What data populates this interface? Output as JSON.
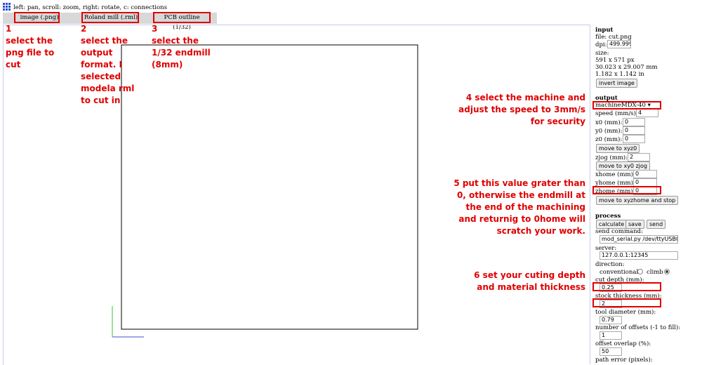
{
  "help_text": "left: pan, scroll: zoom, right: rotate, c: connections",
  "tabs": [
    "image (.png)",
    "Roland mill (.rml)",
    "PCB outline (1/32)"
  ],
  "annotations": {
    "a1": {
      "num": "1",
      "lines": [
        "select the",
        "png file to",
        "cut"
      ]
    },
    "a2": {
      "num": "2",
      "lines": [
        "select the",
        "output",
        "format. I",
        "selected",
        "modela rml",
        "to cut in"
      ]
    },
    "a3": {
      "num": "3",
      "lines": [
        "select the",
        "1/32 endmill",
        "(8mm)"
      ]
    },
    "a4": {
      "lines": [
        "4 select the machine and",
        "adjust the speed to 3mm/s",
        "for security"
      ]
    },
    "a5": {
      "lines": [
        "5 put this value grater than",
        "0, otherwise the endmill at",
        "the end of the machining",
        "and returnig to 0home will",
        "scratch your work."
      ]
    },
    "a6": {
      "lines": [
        "6 set your cuting depth",
        "and material thickness"
      ]
    }
  },
  "panel": {
    "input": {
      "heading": "input",
      "file": "file: cut.png",
      "dpi_label": "dpi:",
      "dpi_value": "499.999",
      "size_label": "size:",
      "size_px": "591 x 571 px",
      "size_mm": "30.023 x 29.007 mm",
      "size_in": "1.182 x 1.142 in",
      "invert_button": "invert image"
    },
    "output": {
      "heading": "output",
      "machine_label": "machine:",
      "machine_value": "MDX-40",
      "speed_label": "speed (mm/s):",
      "speed_value": "4",
      "x0_label": "x0 (mm):",
      "x0_value": "0",
      "y0_label": "y0 (mm):",
      "y0_value": "0",
      "z0_label": "z0 (mm):",
      "z0_value": "0",
      "move_xyz0_button": "move to xyz0",
      "zjog_label": "zjog (mm):",
      "zjog_value": "2",
      "move_xy0_button": "move to xy0 zjog",
      "xhome_label": "xhome (mm):",
      "xhome_value": "0",
      "yhome_label": "yhome (mm):",
      "yhome_value": "0",
      "zhome_label": "zhome (mm):",
      "zhome_value": "0",
      "move_home_button": "move to xyzhome and stop"
    },
    "process": {
      "heading": "process",
      "calculate_button": "calculate",
      "save_button": "save",
      "send_button": "send",
      "send_command_label": "send command:",
      "send_command_value": "mod_serial.py /dev/ttyUSB0",
      "server_label": "server:",
      "server_value": "127.0.0.1:12345",
      "direction_label": "direction:",
      "conventional_label": "conventional",
      "climb_label": "climb",
      "cut_depth_label": "cut depth (mm):",
      "cut_depth_value": "0.25",
      "stock_label": "stock thickness (mm):",
      "stock_value": "2",
      "tool_label": "tool diameter (mm):",
      "tool_value": "0.79",
      "offsets_label": "number of offsets (-1 to fill):",
      "offsets_value": "1",
      "overlap_label": "offset overlap (%):",
      "overlap_value": "50",
      "path_error_label": "path error (pixels):"
    }
  }
}
